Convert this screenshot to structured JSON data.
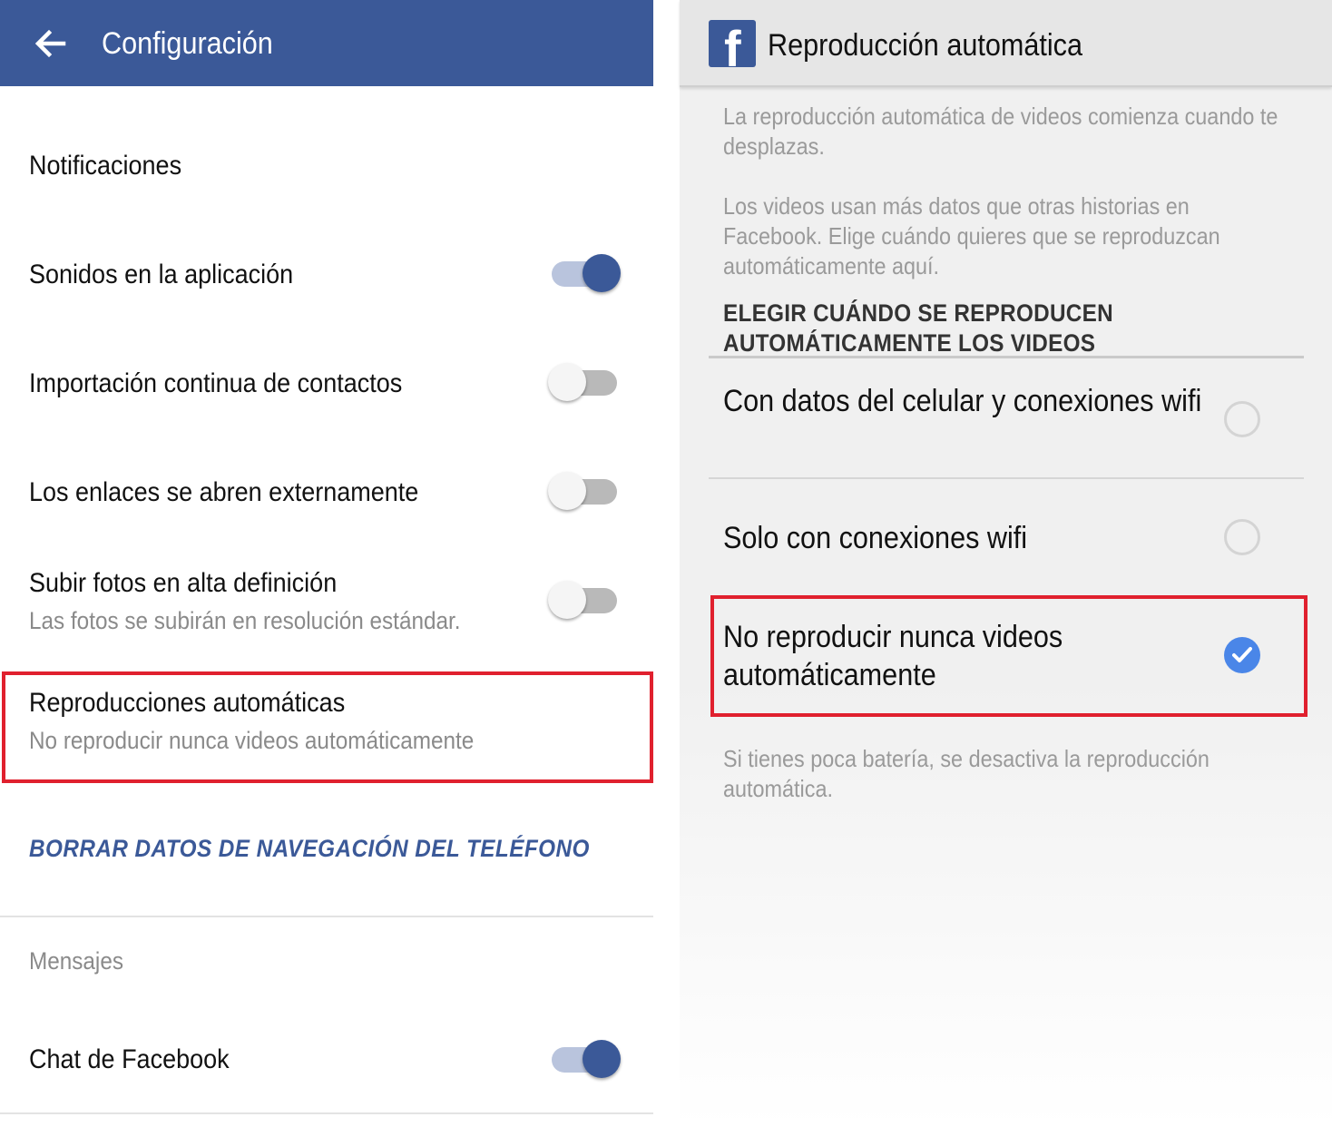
{
  "settings": {
    "title": "Configuración",
    "items": [
      {
        "label": "Notificaciones"
      },
      {
        "label": "Sonidos en la aplicación",
        "toggle": "on"
      },
      {
        "label": "Importación continua de contactos",
        "toggle": "off"
      },
      {
        "label": "Los enlaces se abren externamente",
        "toggle": "off"
      },
      {
        "label": "Subir fotos en alta definición",
        "sublabel": "Las fotos se subirán en resolución estándar.",
        "toggle": "off"
      },
      {
        "label": "Reproducciones automáticas",
        "sublabel": "No reproducir nunca videos automáticamente"
      }
    ],
    "clear_link": "BORRAR DATOS DE NAVEGACIÓN DEL TELÉFONO",
    "section_messages": "Mensajes",
    "chat": {
      "label": "Chat de Facebook",
      "toggle": "on"
    }
  },
  "autoplay": {
    "logo": "f",
    "title": "Reproducción automática",
    "intro": "La reproducción automática de videos comienza cuando te desplazas.",
    "data_note": "Los videos usan más datos que otras historias en Facebook. Elige cuándo quieres que se reproduzcan automáticamente aquí.",
    "heading": "ELEGIR CUÁNDO SE REPRODUCEN AUTOMÁTICAMENTE LOS VIDEOS",
    "options": [
      {
        "label": "Con datos del celular y conexiones wifi",
        "selected": false
      },
      {
        "label": "Solo con conexiones wifi",
        "selected": false
      },
      {
        "label": "No reproducir nunca videos automáticamente",
        "selected": true
      }
    ],
    "footer": "Si tienes poca batería, se desactiva la reproducción automática."
  },
  "colors": {
    "brand": "#3b5998",
    "highlight_box": "#e0202e",
    "radio_checked": "#4a86e8"
  }
}
